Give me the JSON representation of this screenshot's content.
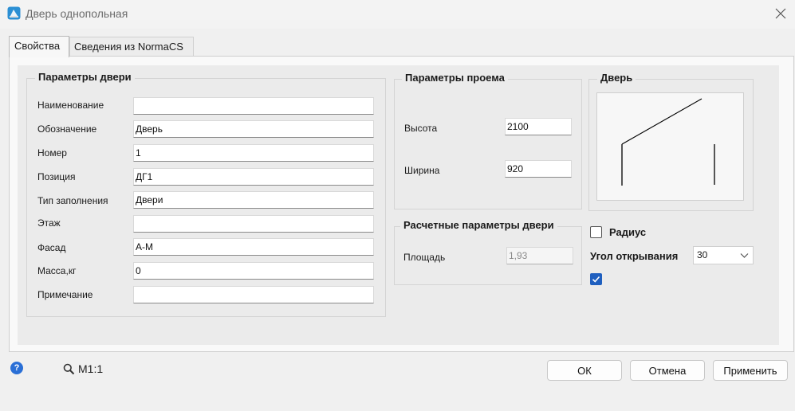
{
  "window": {
    "title": "Дверь однопольная"
  },
  "tabs": [
    {
      "label": "Свойства",
      "active": true
    },
    {
      "label": "Сведения из NormaCS",
      "active": false
    }
  ],
  "door_params": {
    "title": "Параметры двери",
    "fields": [
      {
        "label": "Наименование",
        "value": ""
      },
      {
        "label": "Обозначение",
        "value": "Дверь"
      },
      {
        "label": "Номер",
        "value": "1"
      },
      {
        "label": "Позиция",
        "value": "ДГ1"
      },
      {
        "label": "Тип заполнения",
        "value": "Двери"
      },
      {
        "label": "Этаж",
        "value": ""
      },
      {
        "label": "Фасад",
        "value": "А-М"
      },
      {
        "label": "Масса,кг",
        "value": "0"
      },
      {
        "label": "Примечание",
        "value": ""
      }
    ]
  },
  "opening_params": {
    "title": "Параметры проема",
    "height_label": "Высота",
    "height_value": "2100",
    "width_label": "Ширина",
    "width_value": "920"
  },
  "calc_params": {
    "title": "Расчетные параметры двери",
    "area_label": "Площадь",
    "area_value": "1,93"
  },
  "door_preview": {
    "title": "Дверь"
  },
  "options": {
    "radius_label": "Радиус",
    "radius_checked": false,
    "angle_label": "Угол открывания",
    "angle_value": "30",
    "extra_checked": true
  },
  "footer": {
    "scale_label": "M1:1",
    "ok_label": "ОК",
    "cancel_label": "Отмена",
    "apply_label": "Применить"
  },
  "colors": {
    "accent": "#1f5fbf",
    "help": "#2a6fd6",
    "background": "#f0f0f0"
  }
}
